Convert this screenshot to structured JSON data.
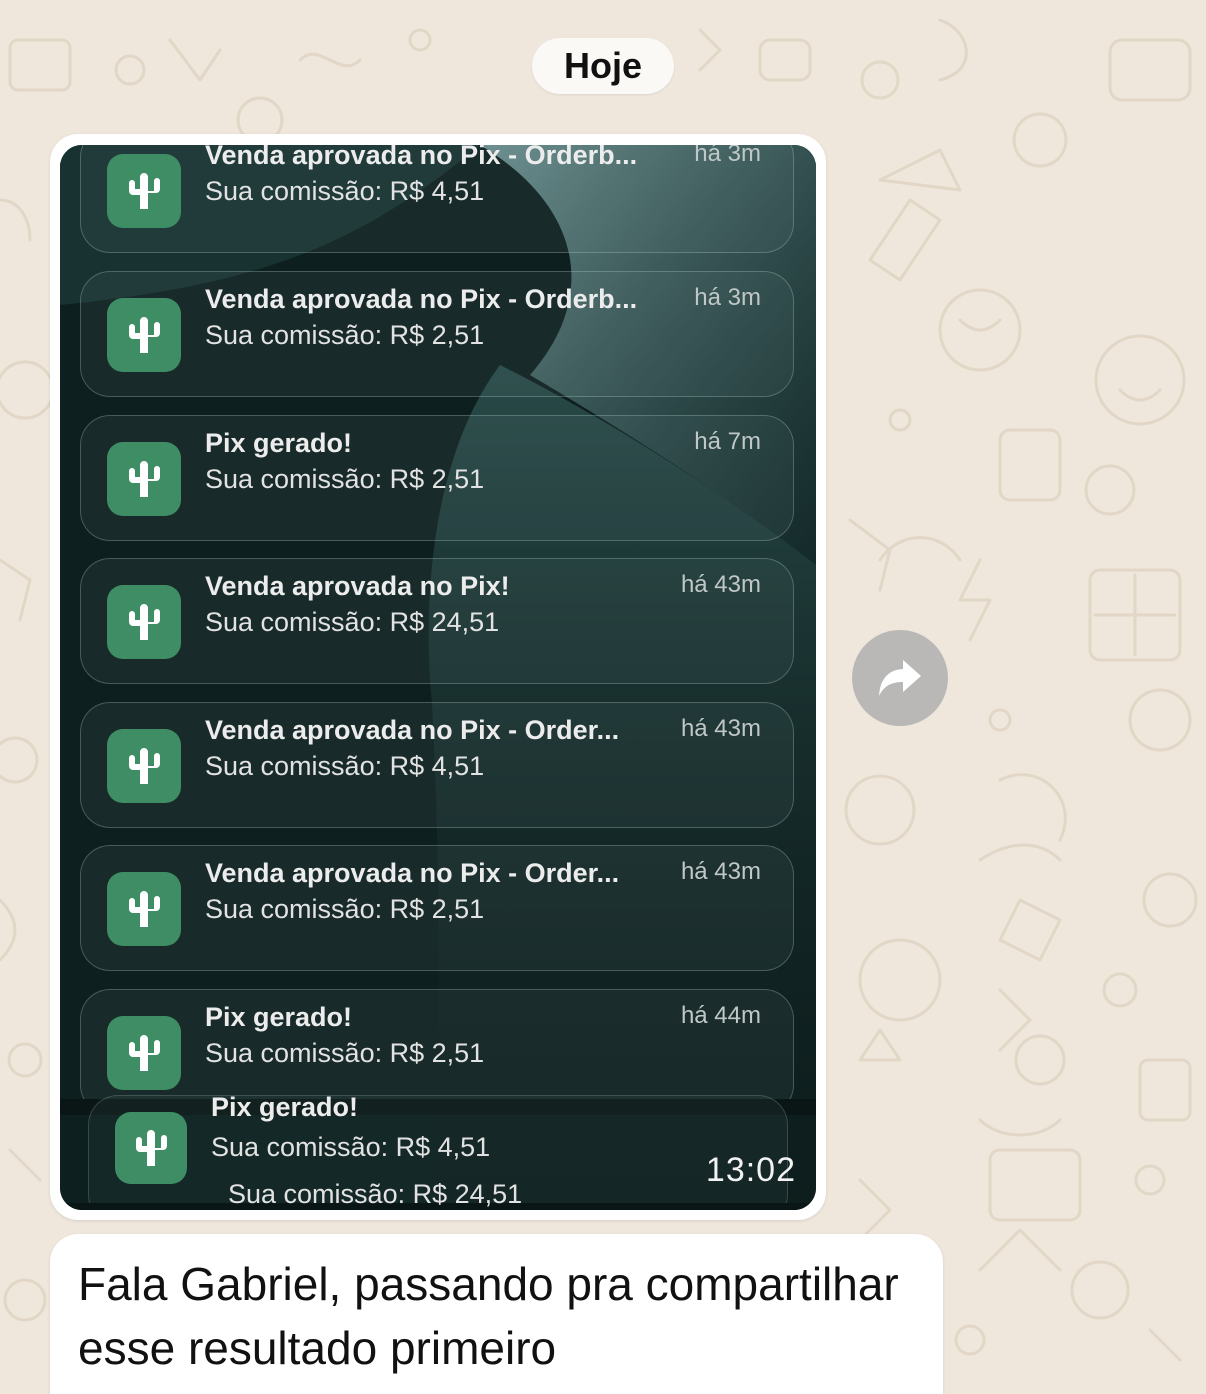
{
  "date_separator": "Hoje",
  "image_message": {
    "timestamp": "13:02",
    "notifications": [
      {
        "icon": "cactus-icon",
        "title": "Venda aprovada no Pix - Orderb...",
        "body": "Sua comissão: R$ 4,51",
        "time": "há 3m"
      },
      {
        "icon": "cactus-icon",
        "title": "Venda aprovada no Pix - Orderb...",
        "body": "Sua comissão: R$ 2,51",
        "time": "há 3m"
      },
      {
        "icon": "cactus-icon",
        "title": "Pix gerado!",
        "body": "Sua comissão: R$ 2,51",
        "time": "há 7m"
      },
      {
        "icon": "cactus-icon",
        "title": "Venda aprovada no Pix!",
        "body": "Sua comissão: R$ 24,51",
        "time": "há 43m"
      },
      {
        "icon": "cactus-icon",
        "title": "Venda aprovada no Pix - Order...",
        "body": "Sua comissão: R$ 4,51",
        "time": "há 43m"
      },
      {
        "icon": "cactus-icon",
        "title": "Venda aprovada no Pix - Order...",
        "body": "Sua comissão: R$ 2,51",
        "time": "há 43m"
      },
      {
        "icon": "cactus-icon",
        "title": "Pix gerado!",
        "body": "Sua comissão: R$ 2,51",
        "time": "há 44m"
      }
    ],
    "stacked_partial": {
      "title": "Pix gerado!",
      "body": "Sua comissão: R$ 4,51",
      "body_below": "Sua comissão: R$ 24,51"
    }
  },
  "forward_button": {
    "icon": "forward-icon"
  },
  "text_message": {
    "text": "Fala Gabriel, passando pra compartilhar esse resultado primeiro"
  },
  "colors": {
    "chat_background": "#efe7dc",
    "bubble": "#ffffff",
    "app_icon": "#3f8d64"
  }
}
